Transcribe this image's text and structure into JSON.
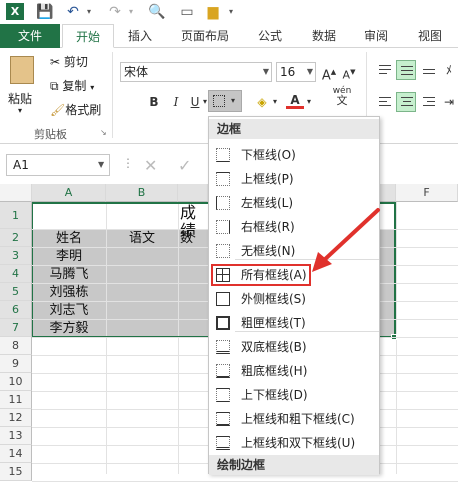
{
  "quick_access": {
    "app_icon": "X",
    "icons": [
      "save-icon",
      "undo-icon",
      "redo-icon",
      "print-preview-icon",
      "open-folder-icon",
      "customize-icon"
    ]
  },
  "tabs": [
    "文件",
    "开始",
    "插入",
    "页面布局",
    "公式",
    "数据",
    "审阅",
    "视图"
  ],
  "active_tab": "开始",
  "ribbon": {
    "clipboard": {
      "paste": "粘贴",
      "cut": "剪切",
      "copy": "复制",
      "format_painter": "格式刷",
      "group_label": "剪贴板"
    },
    "font": {
      "name": "宋体",
      "size": "16",
      "bold": "B",
      "italic": "I",
      "underline": "U",
      "font_color_sample": "A",
      "wen": "wén",
      "wen_char": "文"
    }
  },
  "name_box": "A1",
  "columns": [
    "A",
    "B",
    "F"
  ],
  "rows": [
    "1",
    "2",
    "3",
    "4",
    "5",
    "6",
    "7",
    "8",
    "9",
    "10",
    "11",
    "12",
    "13",
    "14",
    "15"
  ],
  "cells": {
    "title_partial": "成绩",
    "headers": [
      "姓名",
      "语文",
      "数"
    ],
    "names": [
      "李明",
      "马腾飞",
      "刘强栋",
      "刘志飞",
      "李方毅"
    ]
  },
  "border_menu": {
    "header": "边框",
    "items": [
      "下框线(O)",
      "上框线(P)",
      "左框线(L)",
      "右框线(R)",
      "无框线(N)",
      "所有框线(A)",
      "外侧框线(S)",
      "粗匣框线(T)",
      "双底框线(B)",
      "粗底框线(H)",
      "上下框线(D)",
      "上框线和粗下框线(C)",
      "上框线和双下框线(U)"
    ],
    "highlighted": "所有框线(A)",
    "footer_header": "绘制边框"
  },
  "colors": {
    "excel_green": "#217346",
    "highlight_red": "#e0312c",
    "selection_gray": "#c8c8c8"
  }
}
